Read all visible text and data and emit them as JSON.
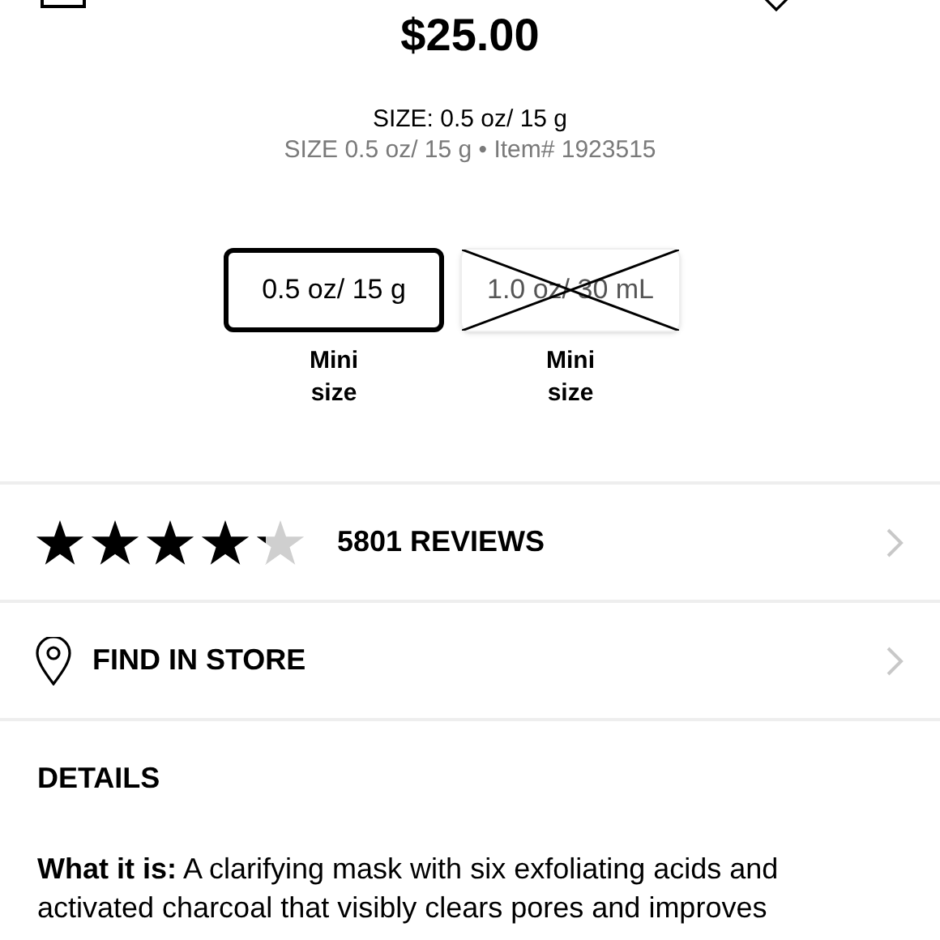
{
  "price": "$25.00",
  "size_label": "SIZE: 0.5 oz/ 15 g",
  "size_info": "SIZE 0.5 oz/ 15 g • Item# 1923515",
  "sizes": [
    {
      "label": "0.5 oz/ 15 g",
      "note": "Mini size",
      "selected": true,
      "available": true
    },
    {
      "label": "1.0 oz/ 30 mL",
      "note": "Mini size",
      "selected": false,
      "available": false
    }
  ],
  "reviews": {
    "stars": 4.2,
    "label": "5801 REVIEWS"
  },
  "find_in_store": {
    "label": "FIND IN STORE"
  },
  "details": {
    "heading": "DETAILS",
    "text": "**What it is:** A clarifying mask with six exfoliating acids and activated charcoal that visibly clears pores and improves"
  }
}
